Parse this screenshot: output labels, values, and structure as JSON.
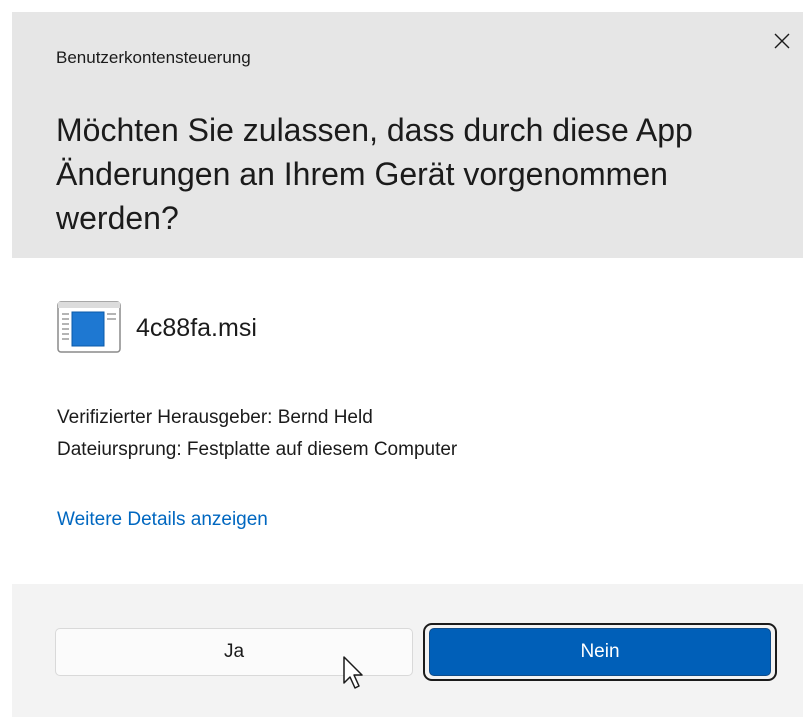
{
  "dialog": {
    "window_title": "Benutzerkontensteuerung",
    "prompt_line1": "Möchten Sie zulassen, dass durch diese App",
    "prompt_line2": "Änderungen an Ihrem Gerät vorgenommen",
    "prompt_line3": "werden?",
    "close_icon": "close-icon"
  },
  "app": {
    "icon": "installer-window-icon",
    "name": "4c88fa.msi"
  },
  "info": {
    "publisher": "Verifizierter Herausgeber: Bernd Held",
    "origin": "Dateiursprung: Festplatte auf diesem Computer"
  },
  "details_link": "Weitere Details anzeigen",
  "buttons": {
    "yes_label": "Ja",
    "no_label": "Nein"
  },
  "colors": {
    "header_bg": "#e6e6e6",
    "footer_bg": "#f3f3f3",
    "accent": "#005fb8",
    "link": "#0067c0"
  }
}
